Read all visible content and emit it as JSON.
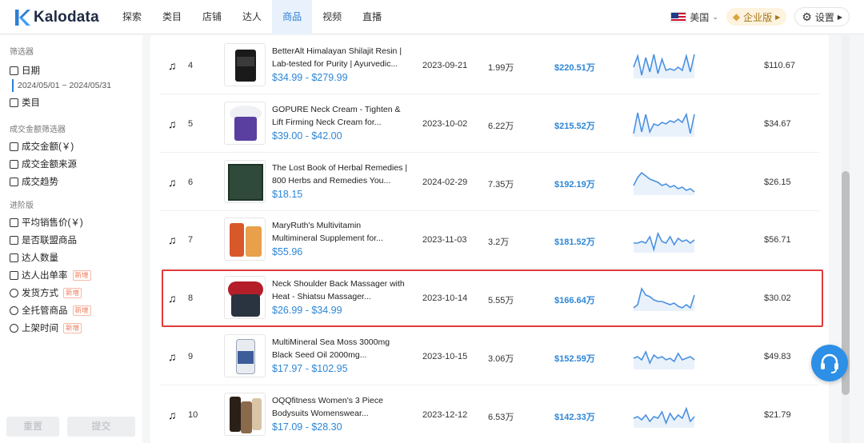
{
  "brand": {
    "name": "Kalodata"
  },
  "nav": {
    "items": [
      "探索",
      "类目",
      "店铺",
      "达人",
      "商品",
      "视频",
      "直播"
    ],
    "active_index": 4
  },
  "header": {
    "country": "美国",
    "enterprise": "企业版",
    "settings": "设置"
  },
  "sidebar": {
    "filter_title": "筛选器",
    "date_label": "日期",
    "date_range": "2024/05/01 ~ 2024/05/31",
    "category_label": "类目",
    "gmv_filter_title": "成交金额筛选器",
    "gmv_items": [
      "成交金额(￥)",
      "成交金额来源",
      "成交趋势"
    ],
    "advanced_title": "进阶版",
    "advanced_items": [
      {
        "label": "平均销售价(￥)",
        "new": ""
      },
      {
        "label": "是否联盟商品",
        "new": ""
      },
      {
        "label": "达人数量",
        "new": ""
      },
      {
        "label": "达人出单率",
        "new": "新增"
      },
      {
        "label": "发货方式",
        "new": "新增"
      },
      {
        "label": "全托管商品",
        "new": "新增"
      },
      {
        "label": "上架时间",
        "new": "新增"
      }
    ],
    "reset": "重置",
    "submit": "提交"
  },
  "rows": [
    {
      "rank": "4",
      "name": "BetterAlt Himalayan Shilajit Resin | Lab-tested for Purity | Ayurvedic...",
      "price": "$34.99 - $279.99",
      "date": "2023-09-21",
      "sales": "1.99万",
      "gmv": "$220.51万",
      "avg_price": "$110.67",
      "trend": [
        20,
        6,
        30,
        8,
        26,
        4,
        28,
        10,
        24,
        22,
        24,
        20,
        24,
        6,
        26,
        4
      ]
    },
    {
      "rank": "5",
      "name": "GOPURE Neck Cream - Tighten & Lift Firming Neck Cream for...",
      "price": "$39.00 - $42.00",
      "date": "2023-10-02",
      "sales": "6.22万",
      "gmv": "$215.52万",
      "avg_price": "$34.67",
      "trend": [
        30,
        4,
        28,
        6,
        28,
        18,
        20,
        16,
        18,
        14,
        16,
        12,
        16,
        6,
        30,
        6
      ]
    },
    {
      "rank": "6",
      "name": "The Lost Book of Herbal Remedies | 800 Herbs and Remedies You...",
      "price": "$18.15",
      "date": "2024-02-29",
      "sales": "7.35万",
      "gmv": "$192.19万",
      "avg_price": "$26.15",
      "trend": [
        22,
        12,
        6,
        10,
        14,
        16,
        18,
        22,
        20,
        24,
        22,
        26,
        24,
        28,
        26,
        30
      ]
    },
    {
      "rank": "7",
      "name": "MaryRuth's Multivitamin Multimineral Supplement for...",
      "price": "$55.96",
      "date": "2023-11-03",
      "sales": "3.2万",
      "gmv": "$181.52万",
      "avg_price": "$56.71",
      "trend": [
        22,
        22,
        20,
        22,
        14,
        30,
        10,
        20,
        22,
        14,
        24,
        16,
        20,
        18,
        22,
        18
      ]
    },
    {
      "rank": "8",
      "name": "Neck Shoulder Back Massager with Heat - Shiatsu Massager...",
      "price": "$26.99 - $34.99",
      "date": "2023-10-14",
      "sales": "5.55万",
      "gmv": "$166.64万",
      "avg_price": "$30.02",
      "trend": [
        30,
        26,
        6,
        14,
        16,
        20,
        22,
        22,
        24,
        26,
        24,
        28,
        30,
        26,
        30,
        14
      ]
    },
    {
      "rank": "9",
      "name": "MultiMineral Sea Moss 3000mg Black Seed Oil 2000mg...",
      "price": "$17.97 - $102.95",
      "date": "2023-10-15",
      "sales": "3.06万",
      "gmv": "$152.59万",
      "avg_price": "$49.83",
      "trend": [
        20,
        18,
        22,
        12,
        26,
        16,
        20,
        18,
        22,
        20,
        24,
        14,
        22,
        20,
        18,
        22
      ]
    },
    {
      "rank": "10",
      "name": "OQQfitness Women's 3 Piece Bodysuits Womenswear...",
      "price": "$17.09 - $28.30",
      "date": "2023-12-12",
      "sales": "6.53万",
      "gmv": "$142.33万",
      "avg_price": "$21.79",
      "trend": [
        22,
        20,
        24,
        18,
        26,
        20,
        22,
        14,
        28,
        16,
        24,
        18,
        22,
        10,
        26,
        20
      ]
    }
  ]
}
